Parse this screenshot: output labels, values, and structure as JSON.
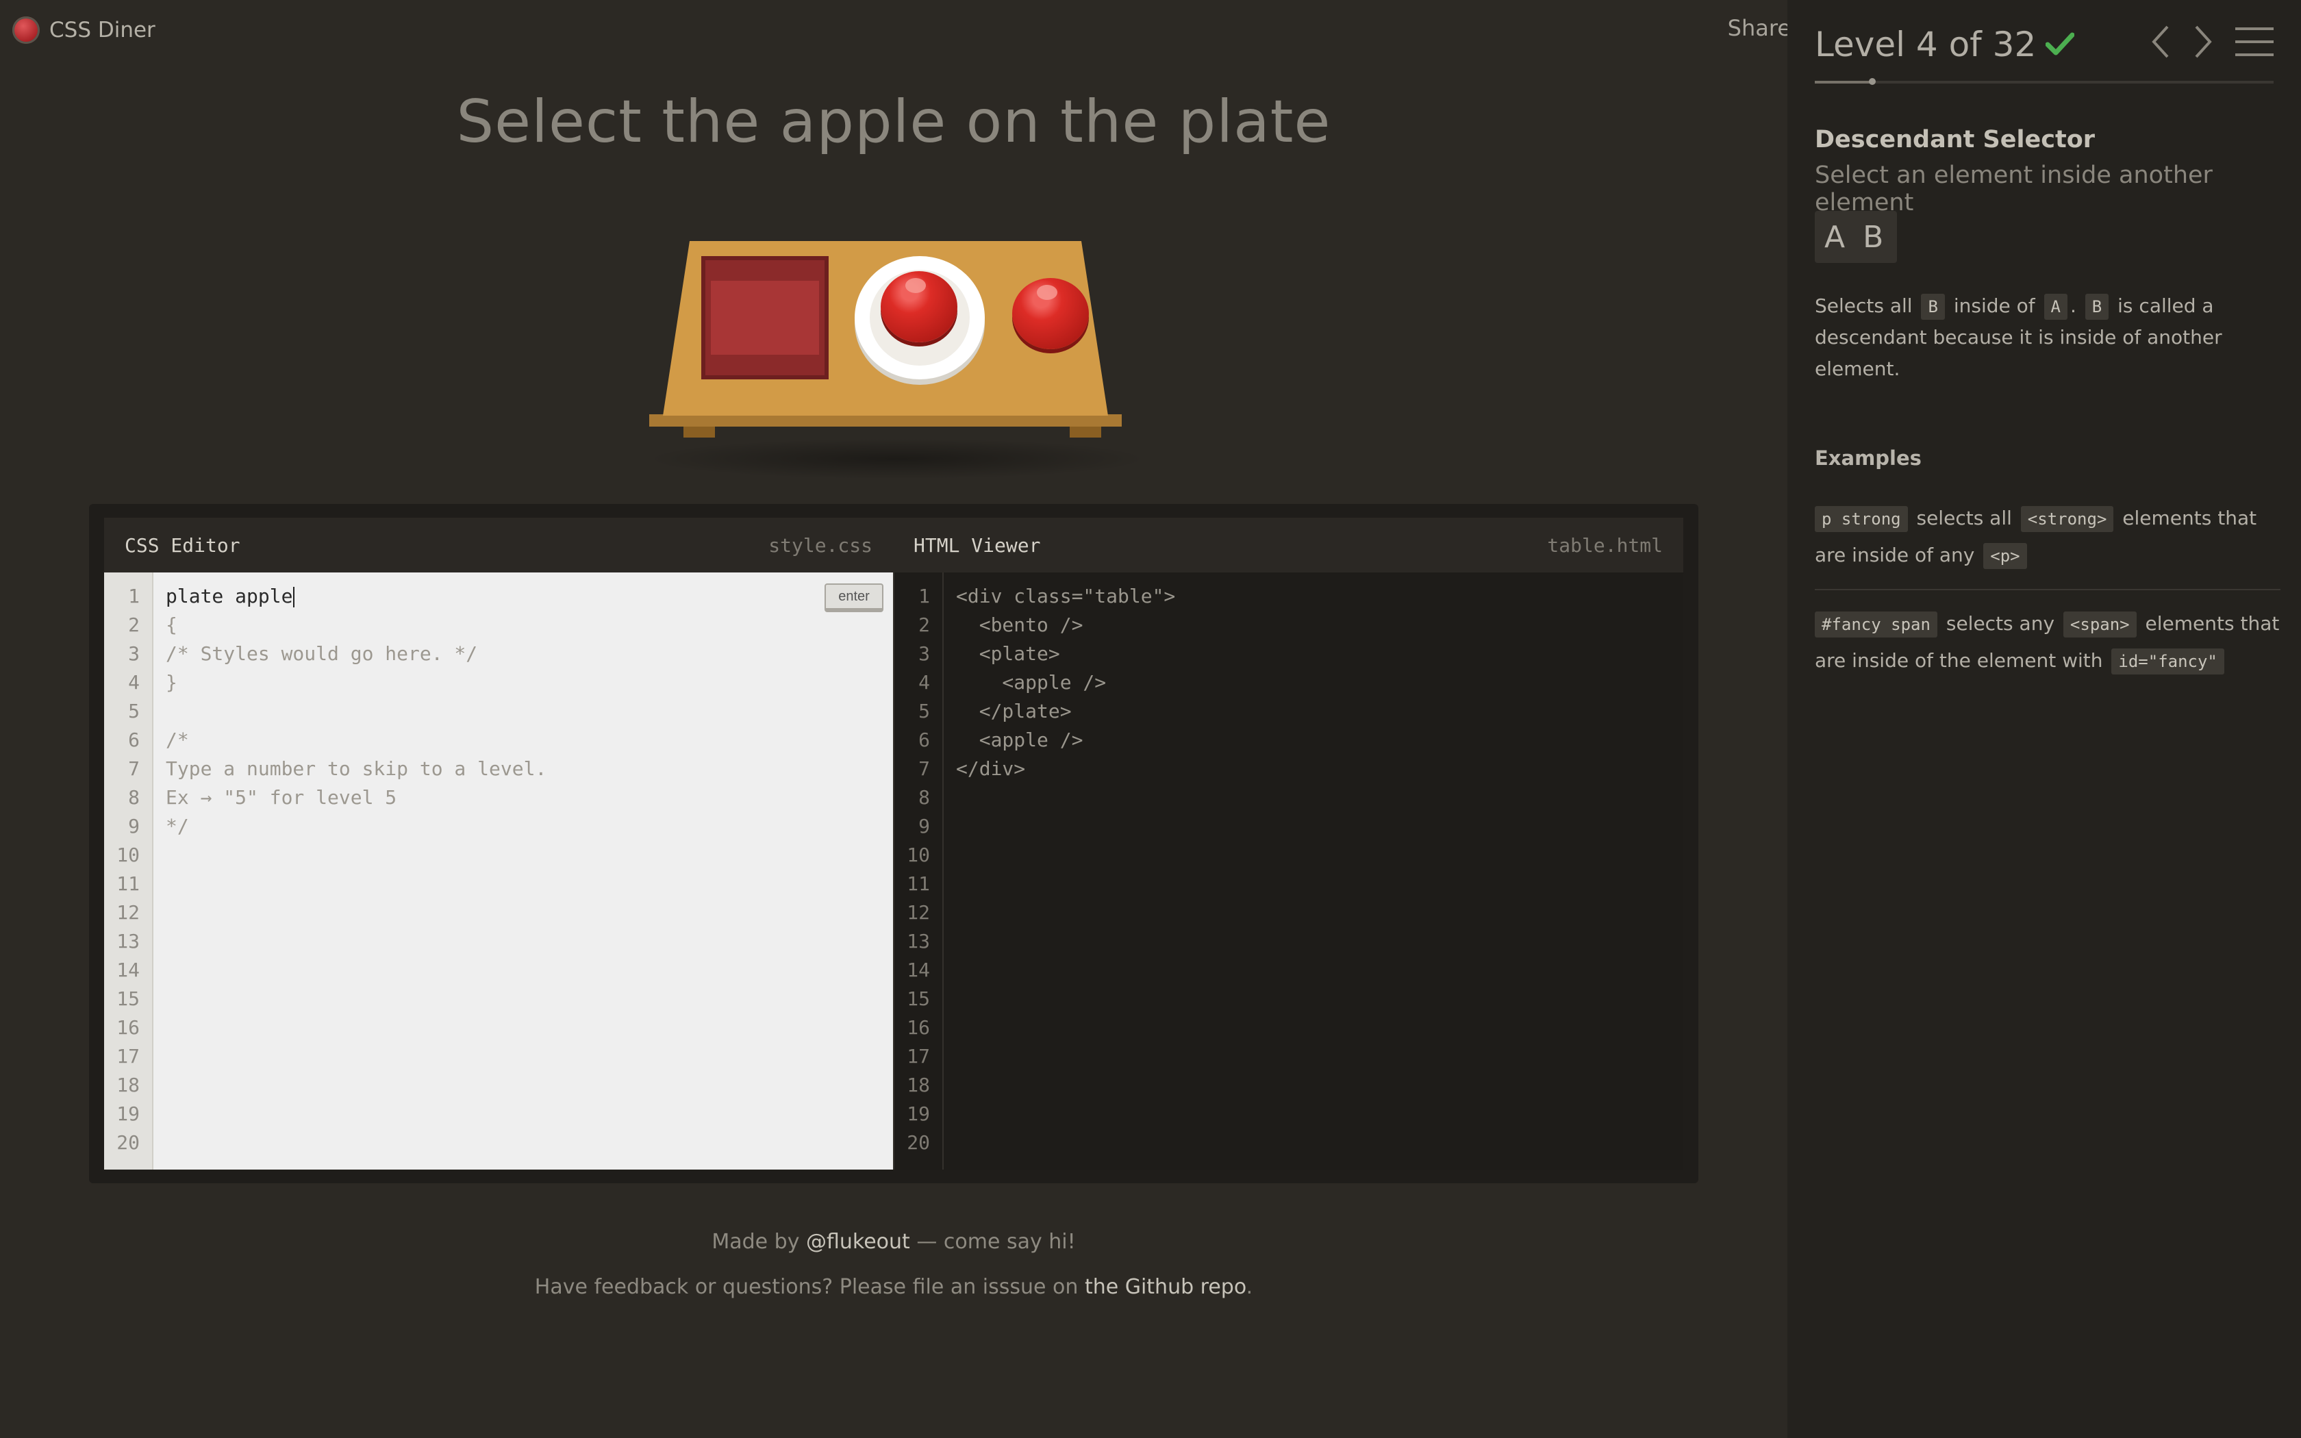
{
  "app": {
    "name": "CSS Diner"
  },
  "share": {
    "label": "Share"
  },
  "level_instruction": "Select the apple on the plate",
  "editor": {
    "css_title": "CSS Editor",
    "css_file": "style.css",
    "html_title": "HTML Viewer",
    "html_file": "table.html",
    "enter_label": "enter",
    "css_input_value": "plate apple",
    "css_lines": [
      "{",
      "/* Styles would go here. */",
      "}",
      "",
      "/*",
      "Type a number to skip to a level.",
      "Ex → \"5\" for level 5",
      "*/"
    ],
    "html_lines": [
      "<div class=\"table\">",
      "  <bento />",
      "  <plate>",
      "    <apple />",
      "  </plate>",
      "  <apple />",
      "</div>"
    ],
    "line_numbers": [
      "1",
      "2",
      "3",
      "4",
      "5",
      "6",
      "7",
      "8",
      "9",
      "10",
      "11",
      "12",
      "13",
      "14",
      "15",
      "16",
      "17",
      "18",
      "19",
      "20"
    ]
  },
  "footer": {
    "line1_prefix": "Made by ",
    "line1_link": "@flukeout",
    "line1_suffix": " — come say hi!",
    "line2_prefix": "Have feedback or questions? Please file an isssue on ",
    "line2_link": "the Github repo",
    "line2_suffix": "."
  },
  "sidebar": {
    "level_label": "Level 4 of 32",
    "completed": true,
    "progress": 0.125,
    "selector_name": "Descendant Selector",
    "selector_desc": "Select an element inside another element",
    "syntax": "A B",
    "hint": {
      "p1": "Selects all ",
      "t1": "B",
      "p2": " inside of ",
      "t2": "A",
      "p3": ". ",
      "t3": "B",
      "p4": " is called a descendant because it is inside of another element."
    },
    "examples_heading": "Examples",
    "example1": {
      "code": "p  strong",
      "p1": " selects all ",
      "tag": "<strong>",
      "p2": " elements that are inside of any ",
      "tag2": "<p>"
    },
    "example2": {
      "code": "#fancy  span",
      "p1": " selects any ",
      "tag": "<span>",
      "p2": " elements that are inside of the element with ",
      "tag2": "id=\"fancy\""
    }
  },
  "colors": {
    "background": "#2c2924",
    "sidebar": "#24221e",
    "check": "#4caf50",
    "apple": "#d62a24",
    "table": "#d29b47"
  },
  "icons": [
    "email-icon",
    "facebook-icon",
    "twitter-icon",
    "checkmark-icon",
    "chevron-left-icon",
    "chevron-right-icon",
    "menu-icon"
  ]
}
